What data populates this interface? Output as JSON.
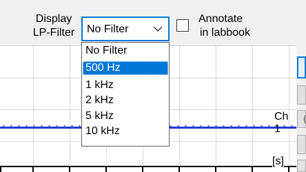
{
  "controls": {
    "display_filter_label": [
      "Display",
      "LP-Filter"
    ],
    "filter_combo": {
      "value": "No Filter",
      "chevron_icon": "chevron-down-icon"
    },
    "annotate_checkbox": {
      "checked": false,
      "label": [
        "Annotate",
        "in labbook"
      ]
    }
  },
  "dropdown": {
    "options": [
      "No Filter",
      "500 Hz",
      "1 kHz",
      "2 kHz",
      "5 kHz",
      "10 kHz"
    ],
    "highlighted": "500 Hz"
  },
  "plot": {
    "channel_label": "Ch 1",
    "time_unit_label": "[s]",
    "trace_color": "#1f3bd6"
  },
  "side_panel": {
    "partial_text": "("
  }
}
